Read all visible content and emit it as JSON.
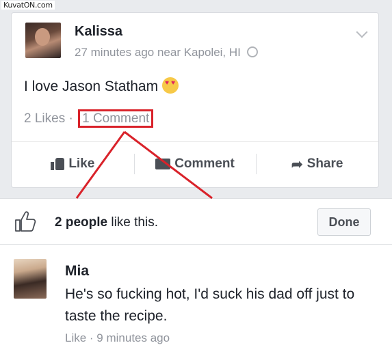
{
  "watermark": "KuvatON.com",
  "post": {
    "author": "Kalissa",
    "meta": "27 minutes ago near Kapolei, HI",
    "text": "I love Jason Statham",
    "likes": "2 Likes",
    "separator": "·",
    "comments": "1 Comment"
  },
  "actions": {
    "like": "Like",
    "comment": "Comment",
    "share": "Share"
  },
  "likes_panel": {
    "count": "2 people",
    "suffix": " like this.",
    "done": "Done"
  },
  "comment": {
    "author": "Mia",
    "text": "He's so fucking hot, I'd suck his dad off just to taste the recipe.",
    "like": "Like",
    "separator": " · ",
    "time": "9 minutes ago"
  },
  "colors": {
    "highlight": "#d9222a",
    "meta_gray": "#90949c"
  }
}
